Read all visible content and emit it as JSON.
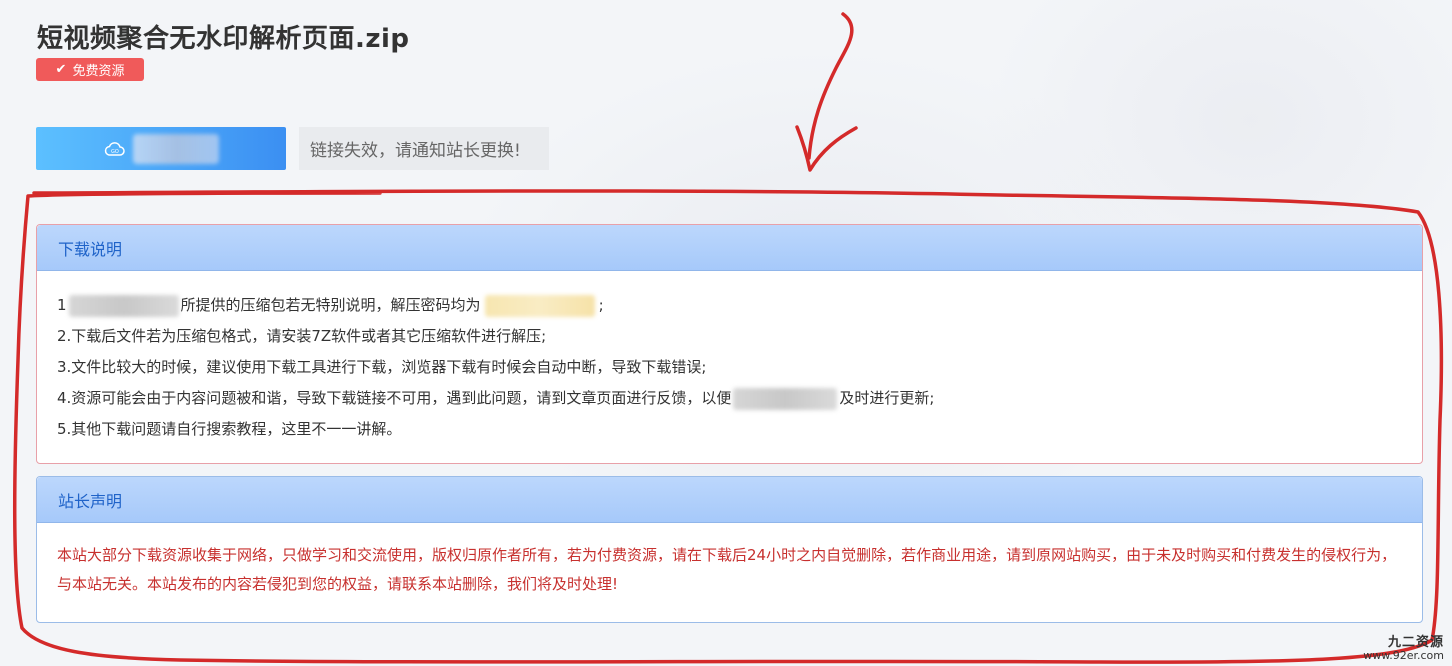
{
  "page": {
    "title": "短视频聚合无水印解析页面.zip",
    "badge": "免费资源",
    "notice": "链接失效，请通知站长更换!"
  },
  "icons": {
    "badge_icon": "check-icon",
    "download_icon": "cloud-icon"
  },
  "download_panel": {
    "title": "下载说明",
    "lines": [
      {
        "pre": "1",
        "post": "所提供的压缩包若无特别说明，解压密码均为",
        "end": ";"
      },
      {
        "text": "2.下载后文件若为压缩包格式，请安装7Z软件或者其它压缩软件进行解压;"
      },
      {
        "text": "3.文件比较大的时候，建议使用下载工具进行下载，浏览器下载有时候会自动中断，导致下载错误;"
      },
      {
        "pre": "4.资源可能会由于内容问题被和谐，导致下载链接不可用，遇到此问题，请到文章页面进行反馈，以便",
        "post": "及时进行更新;"
      },
      {
        "text": "5.其他下载问题请自行搜索教程，这里不一一讲解。"
      }
    ]
  },
  "statement_panel": {
    "title": "站长声明",
    "text": "本站大部分下载资源收集于网络，只做学习和交流使用，版权归原作者所有，若为付费资源，请在下载后24小时之内自觉删除，若作商业用途，请到原网站购买，由于未及时购买和付费发生的侵权行为，与本站无关。本站发布的内容若侵犯到您的权益，请联系本站删除，我们将及时处理!"
  },
  "watermark": {
    "name": "九二资源",
    "url": "www.92er.com"
  },
  "colors": {
    "badge": "#f05a5a",
    "button_start": "#5cc0ff",
    "button_end": "#3b8ff2",
    "panel_header": "#a6c9fa",
    "statement_text": "#c7302e",
    "annotation": "#d42a2a"
  }
}
